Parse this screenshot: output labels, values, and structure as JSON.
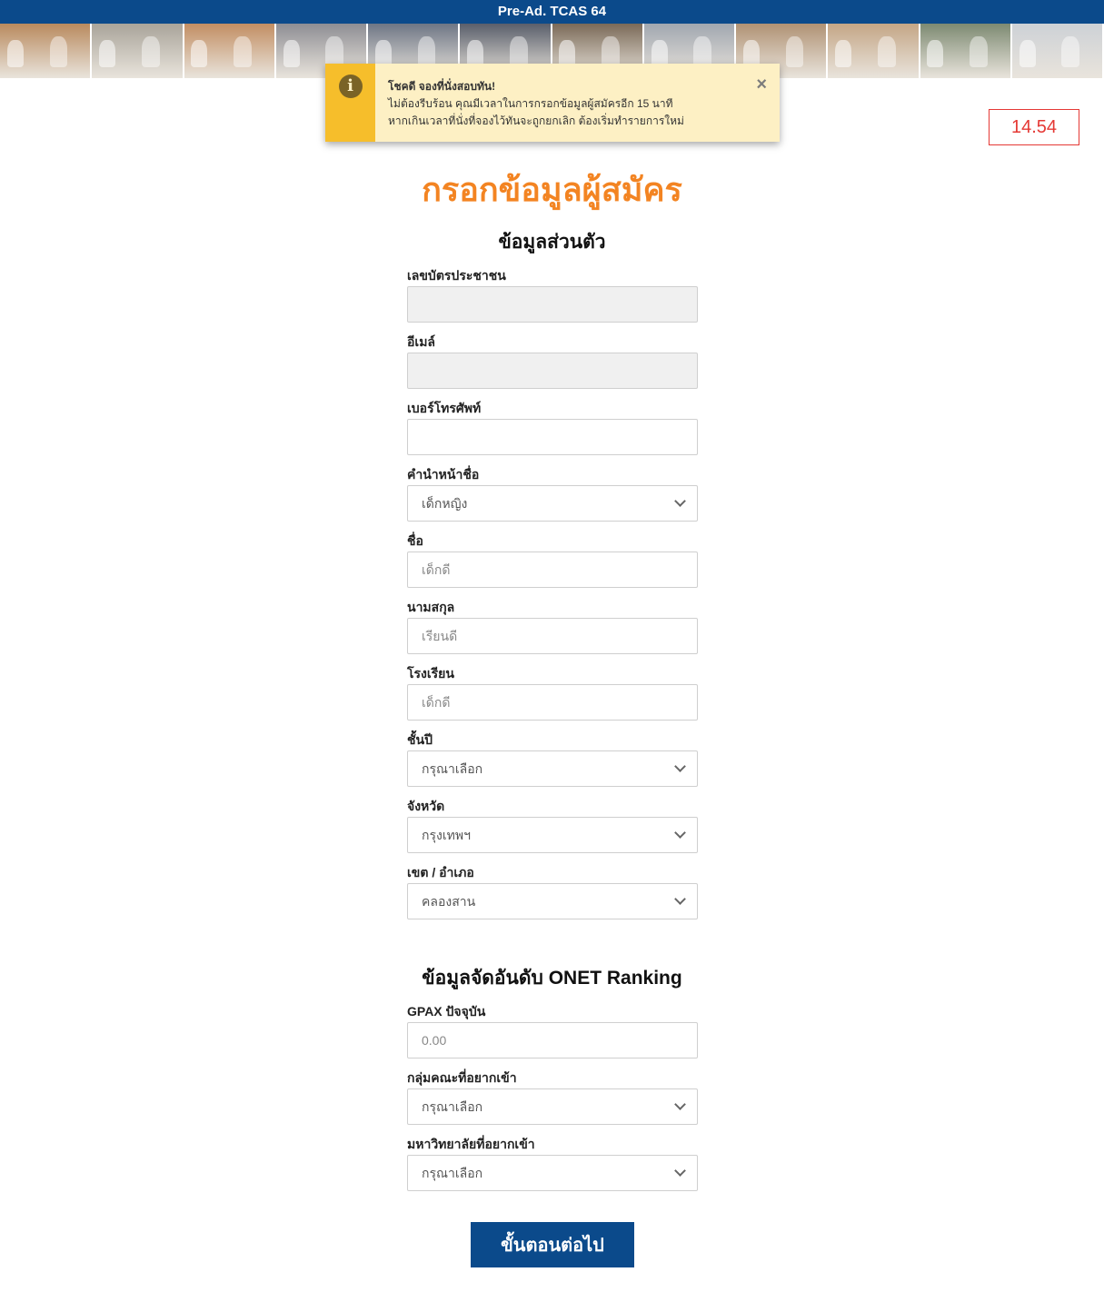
{
  "header": {
    "title": "Pre-Ad. TCAS 64"
  },
  "banner": {
    "tiles": [
      "#b98a5e",
      "#a9a49a",
      "#c28e63",
      "#8e8e94",
      "#6e7685",
      "#5a5f6b",
      "#7b6a58",
      "#a1a7b0",
      "#b09274",
      "#c4a686",
      "#7d8a72",
      "#cdd1d6"
    ]
  },
  "toast": {
    "title": "โชคดี จองที่นั่งสอบทัน!",
    "line1": "ไม่ต้องรีบร้อน คุณมีเวลาในการกรอกข้อมูลผู้สมัครอีก 15 นาที",
    "line2": "หากเกินเวลาที่นั่งที่จองไว้ทันจะถูกยกเลิก ต้องเริ่มทำรายการใหม่",
    "icon": "info-icon",
    "close": "×"
  },
  "timer": "14.54",
  "page_title": "กรอกข้อมูลผู้สมัคร",
  "personal": {
    "heading": "ข้อมูลส่วนตัว",
    "id_card": {
      "label": "เลขบัตรประชาชน",
      "value": ""
    },
    "email": {
      "label": "อีเมล์",
      "value": ""
    },
    "phone": {
      "label": "เบอร์โทรศัพท์",
      "value": ""
    },
    "prefix": {
      "label": "คำนำหน้าชื่อ",
      "value": "เด็กหญิง"
    },
    "first_name": {
      "label": "ชื่อ",
      "placeholder": "เด็กดี"
    },
    "last_name": {
      "label": "นามสกุล",
      "placeholder": "เรียนดี"
    },
    "school": {
      "label": "โรงเรียน",
      "placeholder": "เด็กดี"
    },
    "grade": {
      "label": "ชั้นปี",
      "value": "กรุณาเลือก"
    },
    "province": {
      "label": "จังหวัด",
      "value": "กรุงเทพฯ"
    },
    "district": {
      "label": "เขต / อำเภอ",
      "value": "คลองสาน"
    }
  },
  "ranking": {
    "heading": "ข้อมูลจัดอันดับ ONET Ranking",
    "gpax": {
      "label": "GPAX ปัจจุบัน",
      "placeholder": "0.00"
    },
    "faculty": {
      "label": "กลุ่มคณะที่อยากเข้า",
      "value": "กรุณาเลือก"
    },
    "university": {
      "label": "มหาวิทยาลัยที่อยากเข้า",
      "value": "กรุณาเลือก"
    }
  },
  "next_button": "ขั้นตอนต่อไป"
}
